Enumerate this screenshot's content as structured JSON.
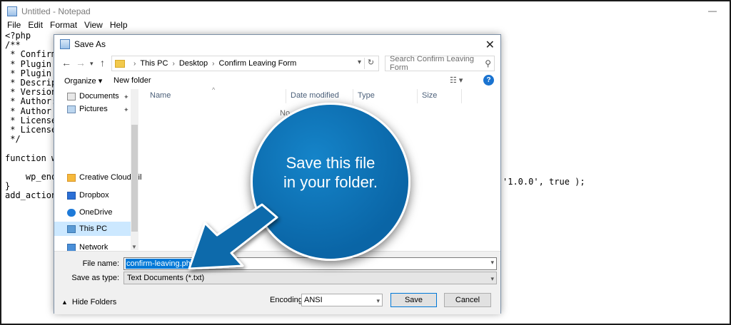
{
  "notepad": {
    "title": "Untitled - Notepad",
    "menu": [
      "File",
      "Edit",
      "Format",
      "View",
      "Help"
    ],
    "lines": [
      "<?php",
      "/**",
      " * Confirm",
      " * Plugin N",
      " * Plugin U",
      " * Descript",
      " * Version:",
      " * Author:",
      " * Author U",
      " * License:",
      " * License ",
      " */",
      "",
      "function wp",
      "",
      "    wp_enq",
      "}",
      "add_action("
    ],
    "tail_text": "'1.0.0', true );"
  },
  "dialog": {
    "title": "Save As",
    "breadcrumb": [
      "This PC",
      "Desktop",
      "Confirm Leaving Form"
    ],
    "search_placeholder": "Search Confirm Leaving Form",
    "organize": "Organize ▾",
    "new_folder": "New folder",
    "nav_items": [
      {
        "label": "Documents",
        "pinned": true
      },
      {
        "label": "Pictures",
        "pinned": true
      },
      {
        "label": "Creative Cloud Fil",
        "pinned": false
      },
      {
        "label": "Dropbox",
        "pinned": false
      },
      {
        "label": "OneDrive",
        "pinned": false
      },
      {
        "label": "This PC",
        "pinned": false,
        "selected": true
      },
      {
        "label": "Network",
        "pinned": false
      }
    ],
    "columns": [
      "Name",
      "Date modified",
      "Type",
      "Size"
    ],
    "empty_text": "No",
    "file_name_label": "File name:",
    "file_name_value": "confirm-leaving.php",
    "save_type_label": "Save as type:",
    "save_type_value": "Text Documents (*.txt)",
    "hide_folders": "Hide Folders",
    "encoding_label": "Encoding:",
    "encoding_value": "ANSI",
    "save_button": "Save",
    "cancel_button": "Cancel"
  },
  "callout": {
    "line1": "Save this file",
    "line2": "in your folder."
  },
  "colors": {
    "callout_blue": "#0a6aab",
    "selection_blue": "#0078d7",
    "nav_selected": "#cce8ff"
  }
}
